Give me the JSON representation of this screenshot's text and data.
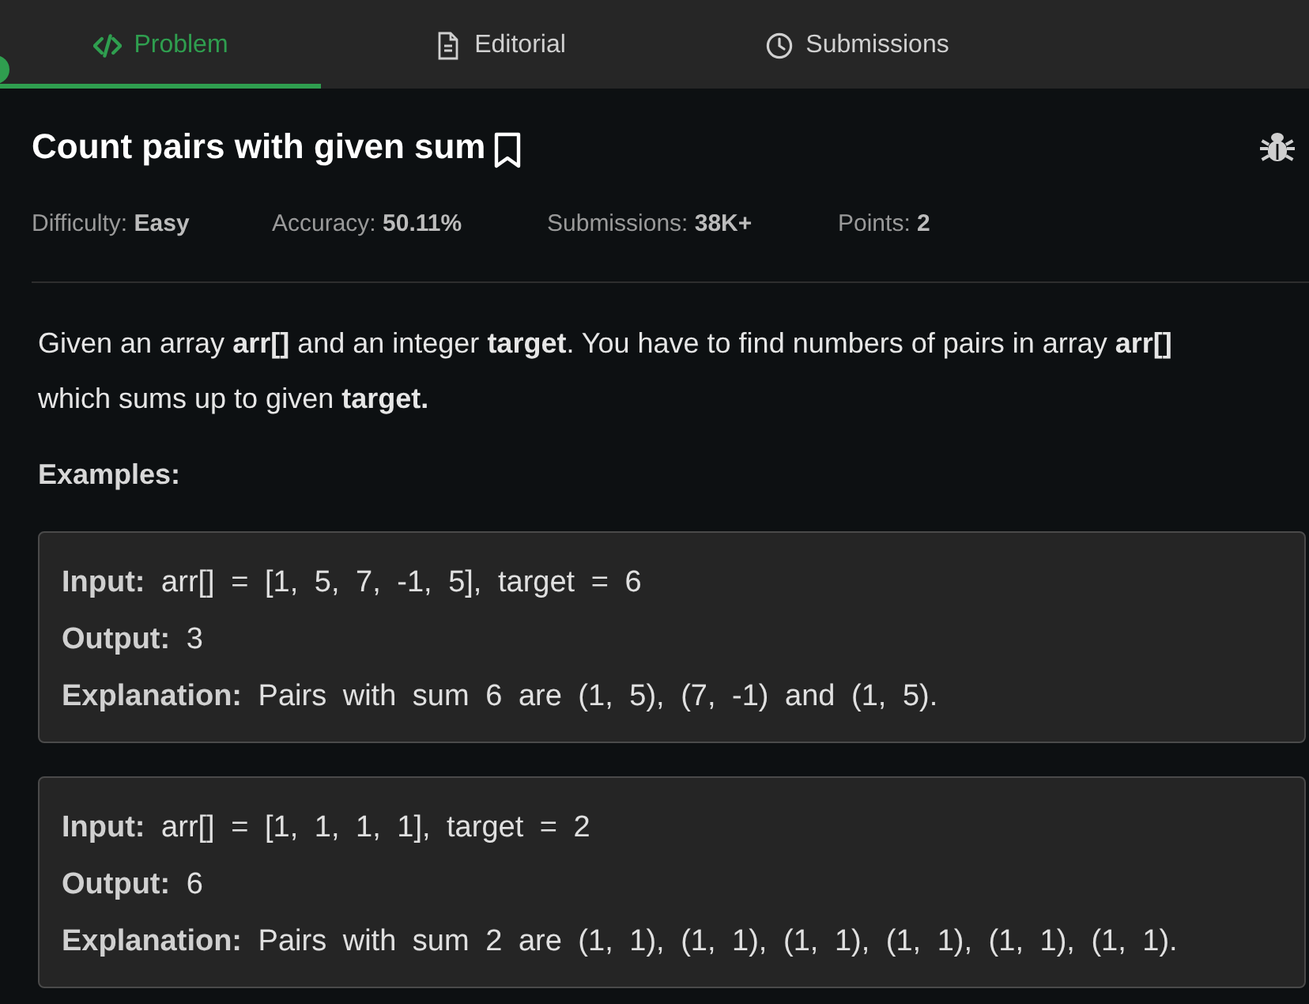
{
  "tabs": [
    {
      "label": "Problem",
      "selected": true
    },
    {
      "label": "Editorial",
      "selected": false
    },
    {
      "label": "Submissions",
      "selected": false
    }
  ],
  "problem": {
    "title": "Count pairs with given sum",
    "meta": [
      {
        "label": "Difficulty:",
        "value": "Easy"
      },
      {
        "label": "Accuracy:",
        "value": "50.11%"
      },
      {
        "label": "Submissions:",
        "value": "38K+"
      },
      {
        "label": "Points:",
        "value": "2"
      }
    ],
    "description": "Given an array **arr[]** and an integer **target**. You have to find numbers of pairs in array **arr[]** which sums up to given **target.**",
    "examples_heading": "Examples:",
    "examples": [
      [
        "**Input:** arr[] = [1, 5, 7, -1, 5], target = 6",
        "**Output:** 3",
        "**Explanation:** Pairs with sum 6 are (1, 5), (7, -1) and (1, 5)."
      ],
      [
        "**Input:** arr[] = [1, 1, 1, 1], target = 2",
        "**Output:** 6",
        "**Explanation:** Pairs with sum 2 are (1, 1), (1, 1), (1, 1), (1, 1), (1, 1), (1, 1)."
      ]
    ]
  }
}
